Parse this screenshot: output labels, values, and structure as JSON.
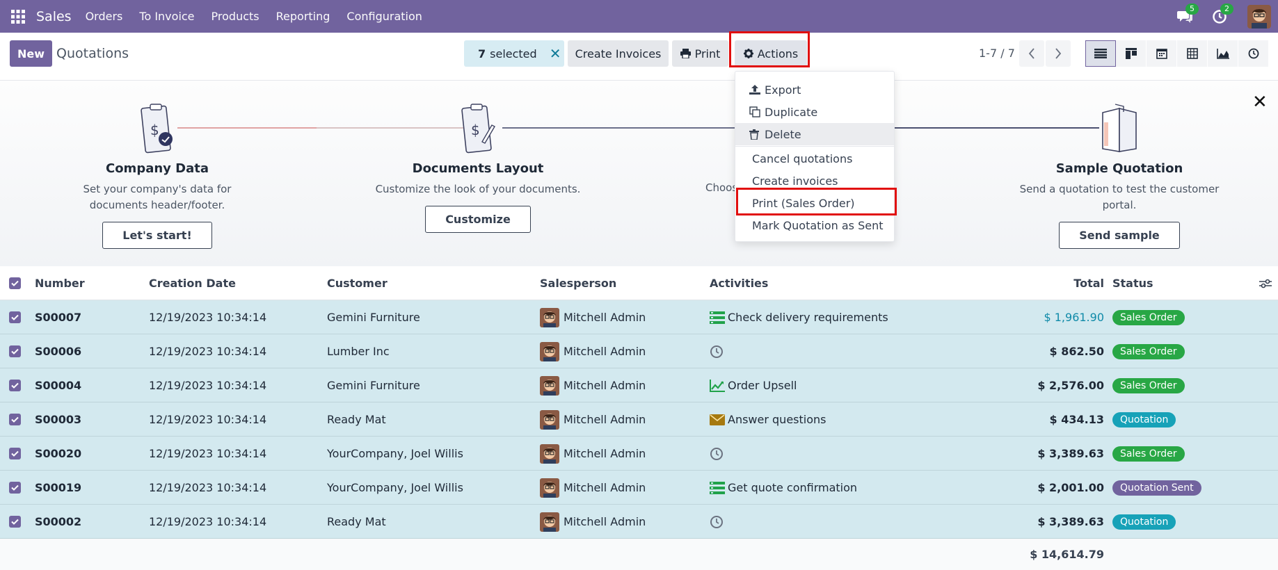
{
  "navbar": {
    "brand": "Sales",
    "menu": [
      "Orders",
      "To Invoice",
      "Products",
      "Reporting",
      "Configuration"
    ],
    "messages_count": "5",
    "activities_count": "2"
  },
  "control": {
    "new_label": "New",
    "title": "Quotations",
    "selected_count": "7",
    "selected_label": "selected",
    "create_invoices_label": "Create Invoices",
    "print_label": "Print",
    "actions_label": "Actions",
    "pager": "1-7 / 7"
  },
  "actions_menu": {
    "export": "Export",
    "duplicate": "Duplicate",
    "delete": "Delete",
    "cancel_quotations": "Cancel quotations",
    "create_invoices": "Create invoices",
    "print_sales_order": "Print (Sales Order)",
    "mark_sent": "Mark Quotation as Sent"
  },
  "banner": {
    "steps": [
      {
        "title": "Company Data",
        "desc": "Set your company's data for documents header/footer.",
        "button": "Let's start!"
      },
      {
        "title": "Documents Layout",
        "desc": "Customize the look of your documents.",
        "button": "Customize"
      },
      {
        "desc_partial": "Choos"
      },
      {
        "title": "Sample Quotation",
        "desc": "Send a quotation to test the customer portal.",
        "button": "Send sample"
      }
    ]
  },
  "table": {
    "columns": {
      "number": "Number",
      "date": "Creation Date",
      "customer": "Customer",
      "salesperson": "Salesperson",
      "activities": "Activities",
      "total": "Total",
      "status": "Status"
    },
    "rows": [
      {
        "number": "S00007",
        "date": "12/19/2023 10:34:14",
        "customer": "Gemini Furniture",
        "salesperson": "Mitchell Admin",
        "activity": "Check delivery requirements",
        "activity_icon": "todo-icon",
        "total": "$ 1,961.90",
        "status": "Sales Order"
      },
      {
        "number": "S00006",
        "date": "12/19/2023 10:34:14",
        "customer": "Lumber Inc",
        "salesperson": "Mitchell Admin",
        "activity": "",
        "activity_icon": "clock-icon",
        "total": "$ 862.50",
        "status": "Sales Order"
      },
      {
        "number": "S00004",
        "date": "12/19/2023 10:34:14",
        "customer": "Gemini Furniture",
        "salesperson": "Mitchell Admin",
        "activity": "Order Upsell",
        "activity_icon": "chart-icon",
        "total": "$ 2,576.00",
        "status": "Sales Order"
      },
      {
        "number": "S00003",
        "date": "12/19/2023 10:34:14",
        "customer": "Ready Mat",
        "salesperson": "Mitchell Admin",
        "activity": "Answer questions",
        "activity_icon": "envelope-icon",
        "total": "$ 434.13",
        "status": "Quotation"
      },
      {
        "number": "S00020",
        "date": "12/19/2023 10:34:14",
        "customer": "YourCompany, Joel Willis",
        "salesperson": "Mitchell Admin",
        "activity": "",
        "activity_icon": "clock-icon",
        "total": "$ 3,389.63",
        "status": "Sales Order"
      },
      {
        "number": "S00019",
        "date": "12/19/2023 10:34:14",
        "customer": "YourCompany, Joel Willis",
        "salesperson": "Mitchell Admin",
        "activity": "Get quote confirmation",
        "activity_icon": "todo-icon",
        "total": "$ 2,001.00",
        "status": "Quotation Sent"
      },
      {
        "number": "S00002",
        "date": "12/19/2023 10:34:14",
        "customer": "Ready Mat",
        "salesperson": "Mitchell Admin",
        "activity": "",
        "activity_icon": "clock-icon",
        "total": "$ 3,389.63",
        "status": "Quotation"
      }
    ],
    "grand_total": "$ 14,614.79"
  },
  "colors": {
    "brand": "#71639e",
    "sales_order": "#28a745",
    "quotation": "#17a2b8",
    "quotation_sent": "#71639e",
    "highlight_box": "#e10e0e"
  }
}
